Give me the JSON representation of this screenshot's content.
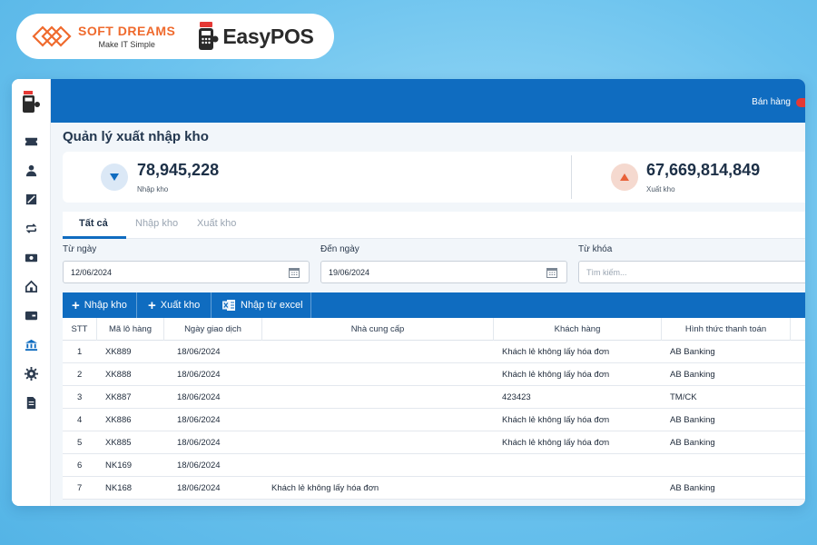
{
  "brand": {
    "softdreams_name": "SOFT DREAMS",
    "softdreams_tagline": "Make IT Simple",
    "easypos_name": "EasyPOS"
  },
  "topbar": {
    "sales_label": "Bán hàng"
  },
  "page": {
    "title": "Quản lý xuất nhập kho"
  },
  "stats": {
    "import_value": "78,945,228",
    "import_label": "Nhập kho",
    "export_value": "67,669,814,849",
    "export_label": "Xuất kho"
  },
  "tabs": [
    {
      "label": "Tất cả",
      "active": true
    },
    {
      "label": "Nhập kho",
      "active": false
    },
    {
      "label": "Xuất kho",
      "active": false
    }
  ],
  "filters": {
    "from_date_label": "Từ ngày",
    "from_date_value": "12/06/2024",
    "to_date_label": "Đến ngày",
    "to_date_value": "19/06/2024",
    "keyword_label": "Từ khóa",
    "keyword_placeholder": "Tìm kiếm..."
  },
  "actions": {
    "import_label": "Nhập kho",
    "export_label": "Xuất kho",
    "excel_label": "Nhập từ excel"
  },
  "table": {
    "headers": [
      "STT",
      "Mã lô hàng",
      "Ngày giao dịch",
      "Nhà cung cấp",
      "Khách hàng",
      "Hình thức thanh toán"
    ],
    "rows": [
      {
        "stt": "1",
        "code": "XK889",
        "date": "18/06/2024",
        "supplier": "",
        "customer": "Khách lẻ không lấy hóa đơn",
        "payment": "AB Banking"
      },
      {
        "stt": "2",
        "code": "XK888",
        "date": "18/06/2024",
        "supplier": "",
        "customer": "Khách lẻ không lấy hóa đơn",
        "payment": "AB Banking"
      },
      {
        "stt": "3",
        "code": "XK887",
        "date": "18/06/2024",
        "supplier": "",
        "customer": "423423",
        "payment": "TM/CK"
      },
      {
        "stt": "4",
        "code": "XK886",
        "date": "18/06/2024",
        "supplier": "",
        "customer": "Khách lẻ không lấy hóa đơn",
        "payment": "AB Banking"
      },
      {
        "stt": "5",
        "code": "XK885",
        "date": "18/06/2024",
        "supplier": "",
        "customer": "Khách lẻ không lấy hóa đơn",
        "payment": "AB Banking"
      },
      {
        "stt": "6",
        "code": "NK169",
        "date": "18/06/2024",
        "supplier": "",
        "customer": "",
        "payment": ""
      },
      {
        "stt": "7",
        "code": "NK168",
        "date": "18/06/2024",
        "supplier": "Khách lẻ không lấy hóa đơn",
        "customer": "",
        "payment": "AB Banking"
      }
    ]
  },
  "colors": {
    "primary": "#0f6cc0",
    "brand_orange": "#ef6a2d",
    "export_accent": "#e8623a"
  }
}
